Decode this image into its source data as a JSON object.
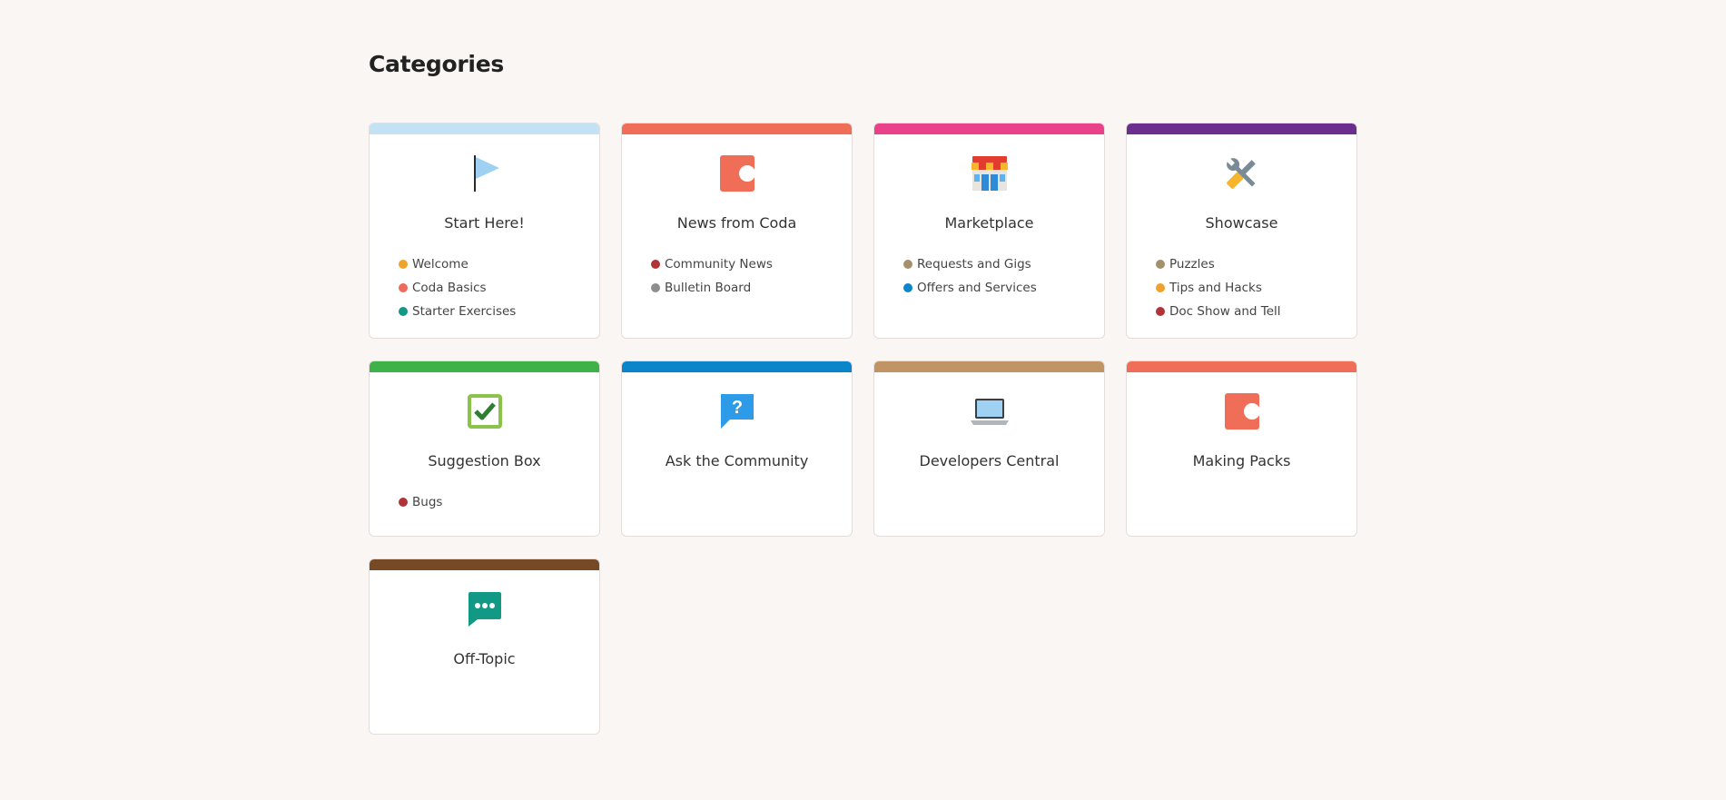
{
  "heading": "Categories",
  "categories": [
    {
      "title": "Start Here!",
      "color": "#c3e3f4",
      "icon": "flag-icon",
      "subcategories": [
        {
          "label": "Welcome",
          "color": "#f0a22b"
        },
        {
          "label": "Coda Basics",
          "color": "#ee6b5c"
        },
        {
          "label": "Starter Exercises",
          "color": "#129985"
        }
      ]
    },
    {
      "title": "News from Coda",
      "color": "#f06d57",
      "icon": "coda-logo-icon",
      "subcategories": [
        {
          "label": "Community News",
          "color": "#b03337"
        },
        {
          "label": "Bulletin Board",
          "color": "#8e8e8e"
        }
      ]
    },
    {
      "title": "Marketplace",
      "color": "#e9418a",
      "icon": "store-icon",
      "subcategories": [
        {
          "label": "Requests and Gigs",
          "color": "#a4906a"
        },
        {
          "label": "Offers and Services",
          "color": "#0a85c9"
        }
      ]
    },
    {
      "title": "Showcase",
      "color": "#6b2e8e",
      "icon": "tools-icon",
      "subcategories": [
        {
          "label": "Puzzles",
          "color": "#a4906a"
        },
        {
          "label": "Tips and Hacks",
          "color": "#f0a22b"
        },
        {
          "label": "Doc Show and Tell",
          "color": "#b03337"
        }
      ]
    },
    {
      "title": "Suggestion Box",
      "color": "#3eb149",
      "icon": "checkbox-icon",
      "subcategories": [
        {
          "label": "Bugs",
          "color": "#b03337"
        }
      ]
    },
    {
      "title": "Ask the Community",
      "color": "#0a85c9",
      "icon": "question-bubble-icon",
      "subcategories": []
    },
    {
      "title": "Developers Central",
      "color": "#c19466",
      "icon": "laptop-icon",
      "subcategories": []
    },
    {
      "title": "Making Packs",
      "color": "#f06d57",
      "icon": "coda-logo-icon",
      "subcategories": []
    },
    {
      "title": "Off-Topic",
      "color": "#754a24",
      "icon": "chat-bubble-icon",
      "subcategories": []
    }
  ]
}
